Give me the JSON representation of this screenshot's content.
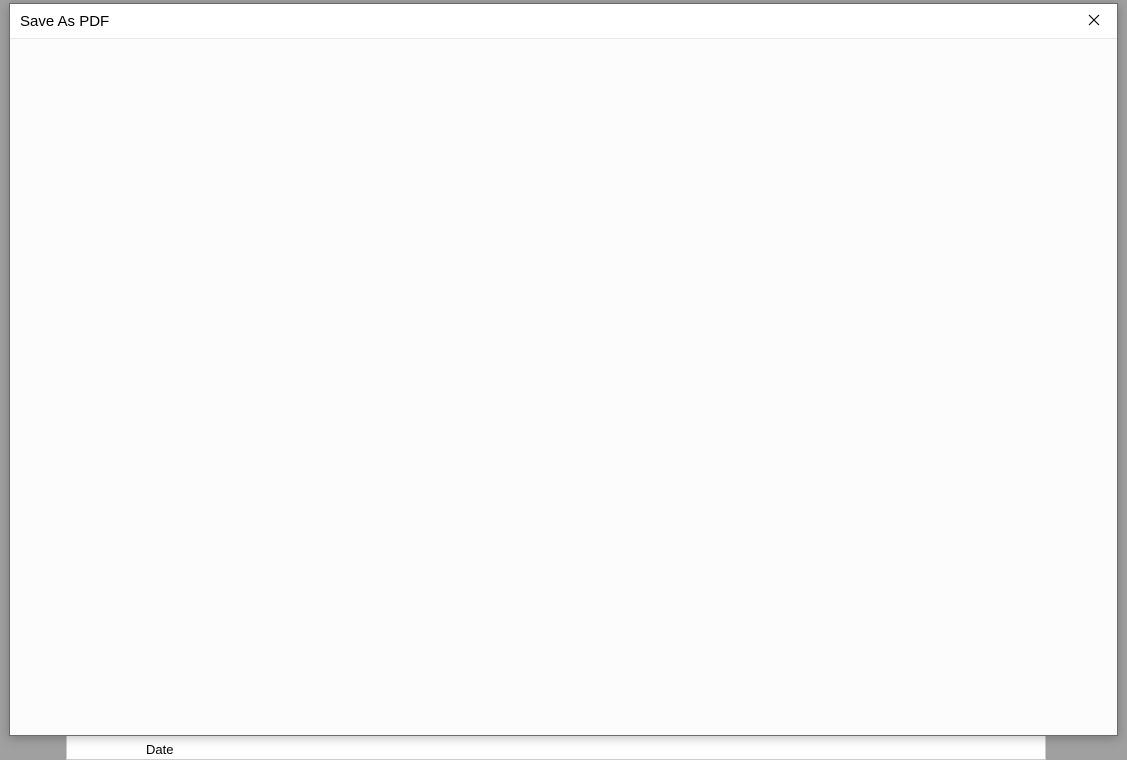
{
  "dialog": {
    "title": "Save As PDF"
  },
  "background": {
    "label": "Date"
  }
}
